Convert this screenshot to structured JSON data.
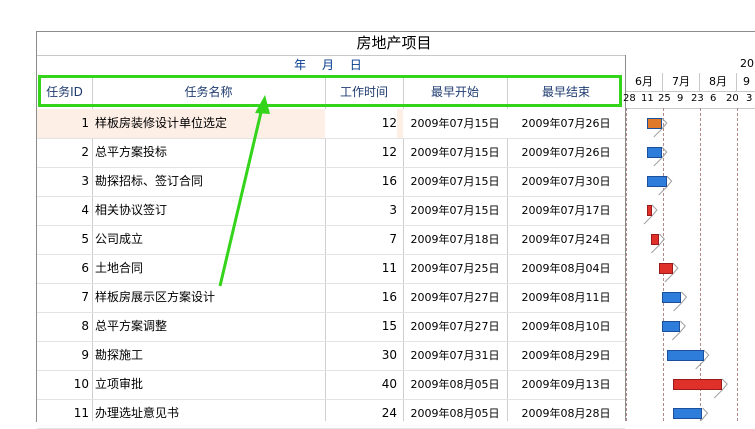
{
  "project": {
    "title": "房地产项目",
    "year": "20",
    "date_label": "年 月 日"
  },
  "columns": {
    "id": "任务ID",
    "name": "任务名称",
    "duration": "工作时间",
    "start": "最早开始",
    "end": "最早结束"
  },
  "gantt": {
    "months": [
      "6月",
      "7月",
      "8月",
      "9"
    ],
    "days": [
      "28",
      "11",
      "25",
      "9",
      "23",
      "6",
      "20",
      "3"
    ]
  },
  "rows": [
    {
      "id": "1",
      "name": "样板房装修设计单位选定",
      "duration": "12",
      "start": "2009年07月15日",
      "end": "2009年07月26日",
      "bar_color": "orange"
    },
    {
      "id": "2",
      "name": "总平方案投标",
      "duration": "12",
      "start": "2009年07月15日",
      "end": "2009年07月26日",
      "bar_color": "blue"
    },
    {
      "id": "3",
      "name": "勘探招标、签订合同",
      "duration": "16",
      "start": "2009年07月15日",
      "end": "2009年07月30日",
      "bar_color": "blue"
    },
    {
      "id": "4",
      "name": "相关协议签订",
      "duration": "3",
      "start": "2009年07月15日",
      "end": "2009年07月17日",
      "bar_color": "red"
    },
    {
      "id": "5",
      "name": "公司成立",
      "duration": "7",
      "start": "2009年07月18日",
      "end": "2009年07月24日",
      "bar_color": "red"
    },
    {
      "id": "6",
      "name": "土地合同",
      "duration": "11",
      "start": "2009年07月25日",
      "end": "2009年08月04日",
      "bar_color": "red"
    },
    {
      "id": "7",
      "name": "样板房展示区方案设计",
      "duration": "16",
      "start": "2009年07月27日",
      "end": "2009年08月11日",
      "bar_color": "blue"
    },
    {
      "id": "8",
      "name": "总平方案调整",
      "duration": "15",
      "start": "2009年07月27日",
      "end": "2009年08月10日",
      "bar_color": "blue"
    },
    {
      "id": "9",
      "name": "勘探施工",
      "duration": "30",
      "start": "2009年07月31日",
      "end": "2009年08月29日",
      "bar_color": "blue"
    },
    {
      "id": "10",
      "name": "立项审批",
      "duration": "40",
      "start": "2009年08月05日",
      "end": "2009年09月13日",
      "bar_color": "red"
    },
    {
      "id": "11",
      "name": "办理选址意见书",
      "duration": "24",
      "start": "2009年08月05日",
      "end": "2009年08月28日",
      "bar_color": "blue"
    }
  ],
  "colors": {
    "highlight": "#33d41a",
    "accent": "#003a8c",
    "critical": "#e0302a",
    "normal": "#2f7ddb"
  }
}
